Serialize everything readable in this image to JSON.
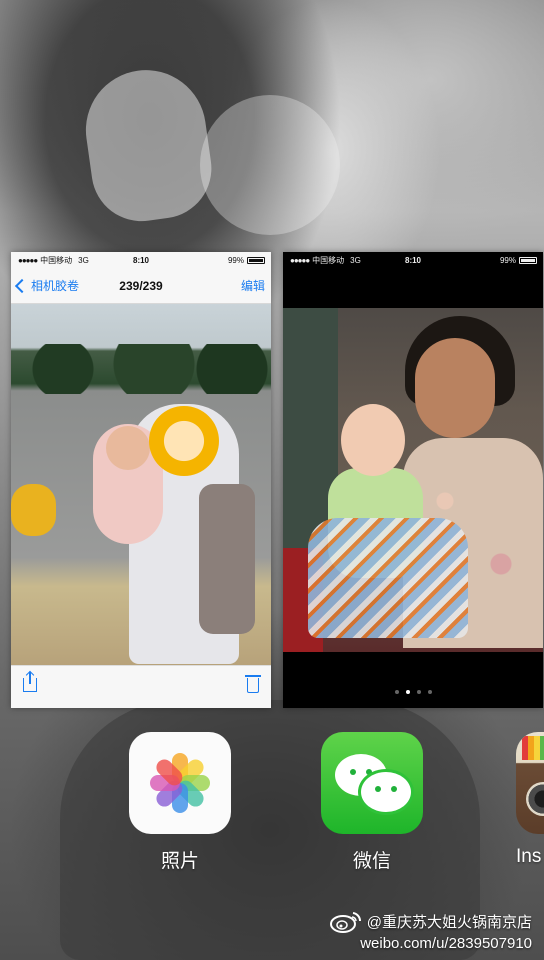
{
  "photos_card": {
    "status": {
      "signal": "●●●●●",
      "carrier": "中国移动",
      "network": "3G",
      "time": "8:10",
      "battery": "99%"
    },
    "nav": {
      "back_label": "相机胶卷",
      "title": "239/239",
      "edit_label": "编辑"
    }
  },
  "wechat_card": {
    "status": {
      "signal": "●●●●●",
      "carrier": "中国移动",
      "network": "3G",
      "time": "8:10",
      "battery": "99%"
    },
    "page_dots": {
      "count": 4,
      "active_index": 1
    }
  },
  "apps": [
    {
      "label": "照片",
      "icon": "photos-flower-icon"
    },
    {
      "label": "微信",
      "icon": "wechat-bubbles-icon"
    },
    {
      "label": "Ins",
      "icon": "instagram-camera-icon"
    }
  ],
  "watermark": {
    "handle": "@重庆苏大姐火锅南京店",
    "url": "weibo.com/u/2839507910",
    "logo": "weibo-logo-icon"
  },
  "colors": {
    "ios_blue": "#1a7cf0",
    "wechat_green": "#1eb52a"
  }
}
